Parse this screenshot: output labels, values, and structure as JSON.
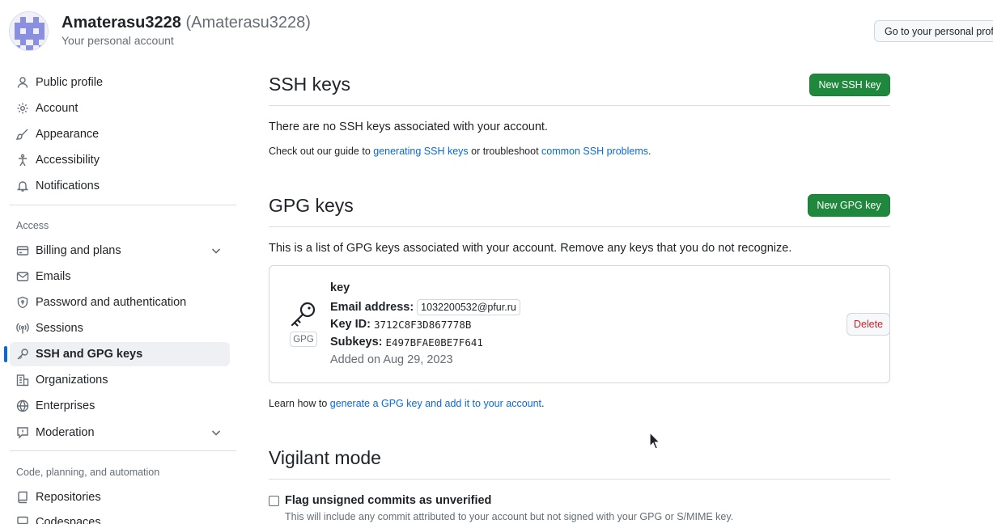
{
  "header": {
    "account_name": "Amaterasu3228",
    "account_login": "(Amaterasu3228)",
    "subtitle": "Your personal account",
    "goto_button": "Go to your personal profile"
  },
  "sidebar": {
    "items_top": [
      {
        "label": "Public profile",
        "icon": "person-icon"
      },
      {
        "label": "Account",
        "icon": "gear-icon"
      },
      {
        "label": "Appearance",
        "icon": "paintbrush-icon"
      },
      {
        "label": "Accessibility",
        "icon": "accessibility-icon"
      },
      {
        "label": "Notifications",
        "icon": "bell-icon"
      }
    ],
    "access_heading": "Access",
    "items_access": [
      {
        "label": "Billing and plans",
        "icon": "credit-card-icon",
        "expandable": true
      },
      {
        "label": "Emails",
        "icon": "mail-icon"
      },
      {
        "label": "Password and authentication",
        "icon": "shield-lock-icon"
      },
      {
        "label": "Sessions",
        "icon": "broadcast-icon"
      },
      {
        "label": "SSH and GPG keys",
        "icon": "key-icon",
        "active": true
      },
      {
        "label": "Organizations",
        "icon": "organization-icon"
      },
      {
        "label": "Enterprises",
        "icon": "globe-icon"
      },
      {
        "label": "Moderation",
        "icon": "report-icon",
        "expandable": true
      }
    ],
    "code_heading": "Code, planning, and automation",
    "items_code": [
      {
        "label": "Repositories",
        "icon": "repo-icon"
      },
      {
        "label": "Codespaces",
        "icon": "codespaces-icon"
      }
    ]
  },
  "ssh": {
    "title": "SSH keys",
    "new_button": "New SSH key",
    "empty_text": "There are no SSH keys associated with your account.",
    "guide_prefix": "Check out our guide to ",
    "guide_link1": "generating SSH keys",
    "guide_mid": " or troubleshoot ",
    "guide_link2": "common SSH problems",
    "guide_suffix": "."
  },
  "gpg": {
    "title": "GPG keys",
    "new_button": "New GPG key",
    "intro": "This is a list of GPG keys associated with your account. Remove any keys that you do not recognize.",
    "key": {
      "badge": "GPG",
      "name": "key",
      "email_label": "Email address:",
      "email": "1032200532@pfur.ru",
      "keyid_label": "Key ID:",
      "keyid": "3712C8F3D867778B",
      "subkeys_label": "Subkeys:",
      "subkeys": "E497BFAE0BE7F641",
      "added": "Added on Aug 29, 2023",
      "delete_button": "Delete"
    },
    "learn_prefix": "Learn how to ",
    "learn_link": "generate a GPG key and add it to your account",
    "learn_suffix": "."
  },
  "vigilant": {
    "title": "Vigilant mode",
    "checkbox_label": "Flag unsigned commits as unverified",
    "checkbox_checked": false,
    "note": "This will include any commit attributed to your account but not signed with your GPG or S/MIME key."
  }
}
